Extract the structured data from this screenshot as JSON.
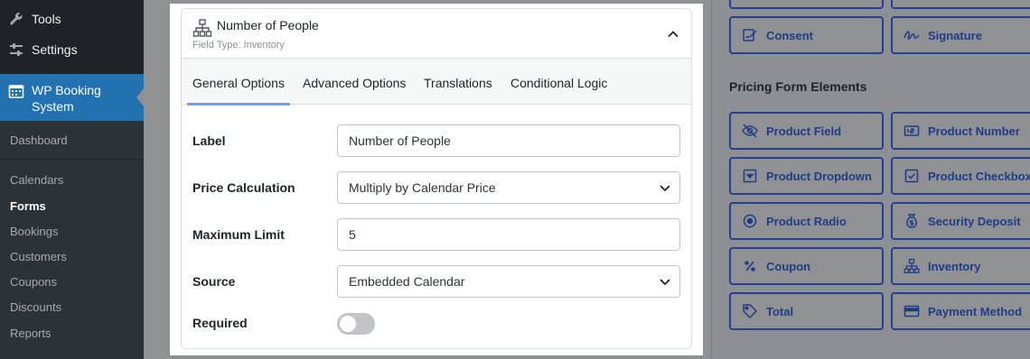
{
  "sidebar": {
    "items": [
      {
        "label": "Tools",
        "icon": "wrench-icon"
      },
      {
        "label": "Settings",
        "icon": "settings-sliders-icon"
      },
      {
        "label": "WP Booking System",
        "icon": "calendar-icon"
      }
    ],
    "submenu": [
      "Dashboard",
      "Calendars",
      "Forms",
      "Bookings",
      "Customers",
      "Coupons",
      "Discounts",
      "Reports"
    ],
    "current_submenu": "Forms"
  },
  "panel": {
    "title": "Number of People",
    "field_type": "Field Type: Inventory",
    "tabs": [
      "General Options",
      "Advanced Options",
      "Translations",
      "Conditional Logic"
    ],
    "active_tab": "General Options",
    "fields": {
      "label": {
        "label": "Label",
        "value": "Number of People"
      },
      "price_calculation": {
        "label": "Price Calculation",
        "value": "Multiply by Calendar Price"
      },
      "maximum_limit": {
        "label": "Maximum Limit",
        "value": "5"
      },
      "source": {
        "label": "Source",
        "value": "Embedded Calendar"
      },
      "required": {
        "label": "Required",
        "value": false
      }
    }
  },
  "elements": {
    "top": [
      {
        "label": "Consent",
        "icon": "consent-icon"
      },
      {
        "label": "Signature",
        "icon": "signature-icon"
      }
    ],
    "pricing_title": "Pricing Form Elements",
    "pricing": [
      {
        "label": "Product Field",
        "icon": "eye-slash-icon"
      },
      {
        "label": "Product Number",
        "icon": "number-card-icon"
      },
      {
        "label": "Product Dropdown",
        "icon": "dropdown-icon"
      },
      {
        "label": "Product Checkbox",
        "icon": "checkbox-icon"
      },
      {
        "label": "Product Radio",
        "icon": "radio-icon"
      },
      {
        "label": "Security Deposit",
        "icon": "money-bag-icon"
      },
      {
        "label": "Coupon",
        "icon": "percent-icon"
      },
      {
        "label": "Inventory",
        "icon": "hierarchy-icon"
      },
      {
        "label": "Total",
        "icon": "tag-icon"
      },
      {
        "label": "Payment Method",
        "icon": "credit-card-icon"
      }
    ]
  },
  "colors": {
    "admin_sidebar": "#1d2327",
    "admin_active": "#2271b1",
    "element_border": "#23418f",
    "tab_underline": "#7a9de0"
  }
}
